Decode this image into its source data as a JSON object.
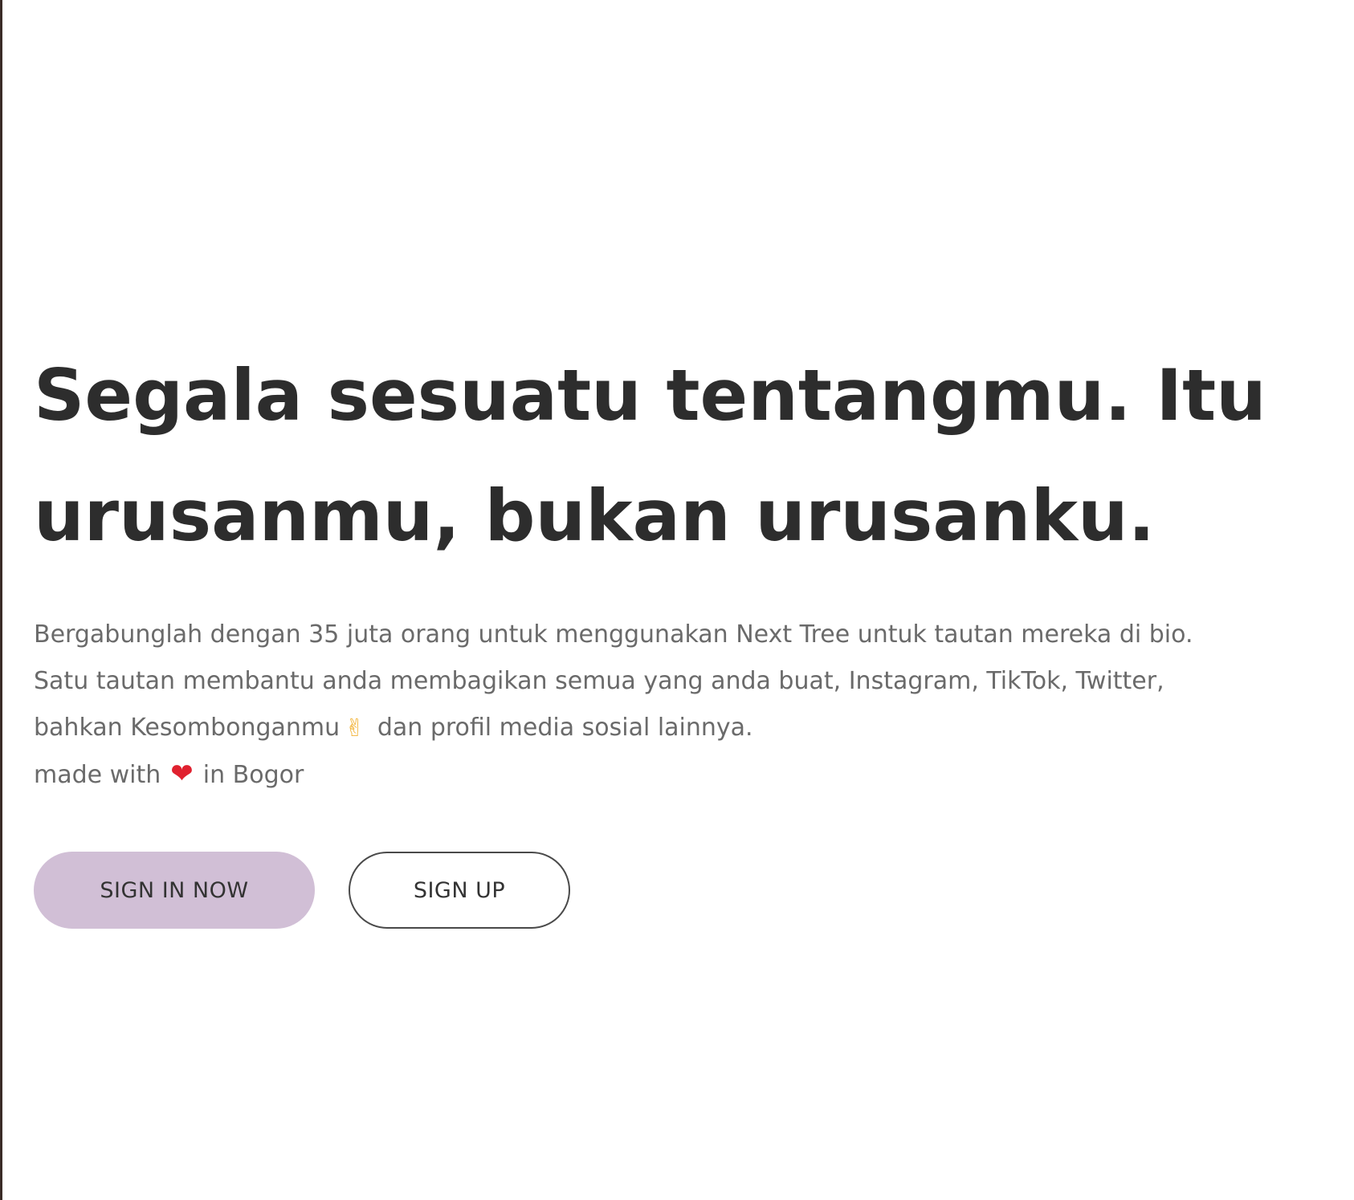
{
  "hero": {
    "headline_line1": "Segala sesuatu tentangmu. Itu",
    "headline_line2": "urusanmu, bukan urusanku.",
    "description_line1": "Bergabunglah dengan 35 juta orang untuk menggunakan Next Tree untuk tautan mereka di bio.",
    "description_line2": "Satu tautan membantu anda membagikan semua yang anda buat, Instagram, TikTok, Twitter,",
    "description_line3_pre": "bahkan Kesombonganmu",
    "description_line3_emoji": "✌",
    "description_line3_post": "dan profil media sosial lainnya.",
    "made_with_pre": "made with",
    "made_with_emoji": "❤",
    "made_with_post": "in Bogor"
  },
  "buttons": {
    "signin_label": "SIGN IN NOW",
    "signup_label": "SIGN UP"
  },
  "colors": {
    "headline": "#2d2d2d",
    "body_text": "#6a6a6a",
    "signin_bg": "#d1bfd6",
    "signup_border": "#4a4a4a",
    "heart": "#e0212f",
    "peace": "#f2b233"
  },
  "icons": {
    "peace": "victory-hand-icon",
    "heart": "red-heart-icon"
  }
}
